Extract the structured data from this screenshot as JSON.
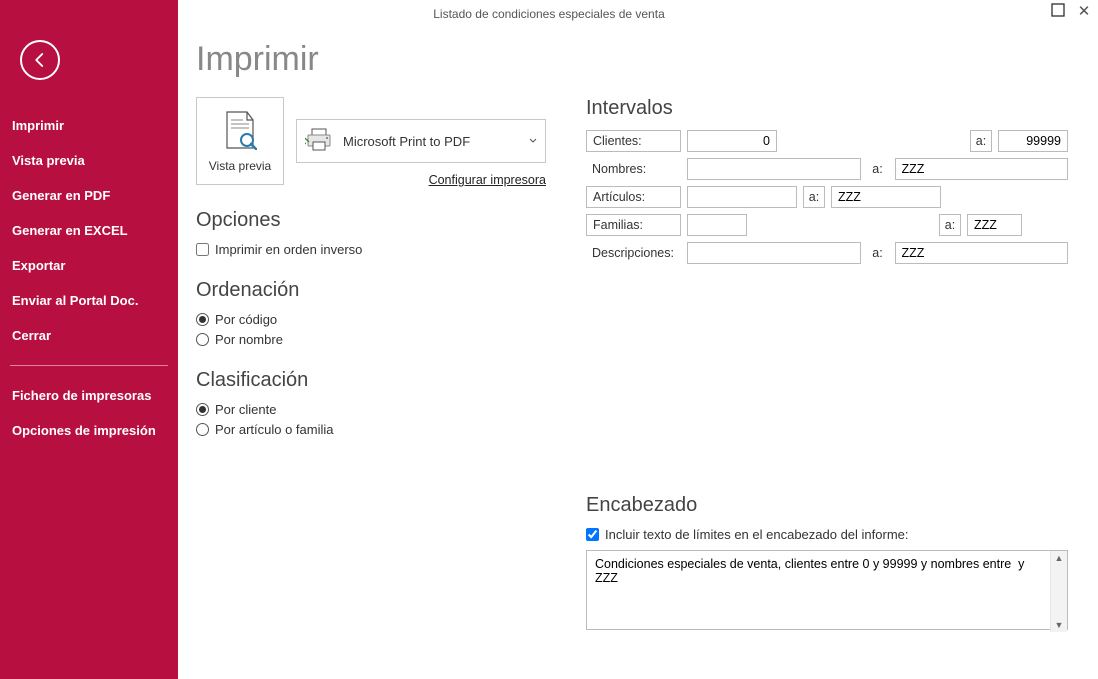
{
  "window": {
    "title": "Listado de condiciones especiales de venta"
  },
  "sidebar": {
    "items": [
      "Imprimir",
      "Vista previa",
      "Generar en PDF",
      "Generar en EXCEL",
      "Exportar",
      "Enviar al Portal Doc.",
      "Cerrar"
    ],
    "items2": [
      "Fichero de impresoras",
      "Opciones de impresión"
    ]
  },
  "page": {
    "title": "Imprimir"
  },
  "preview": {
    "label": "Vista previa"
  },
  "printer": {
    "name": "Microsoft Print to PDF",
    "config_link": "Configurar impresora"
  },
  "opciones": {
    "title": "Opciones",
    "inverse_label": "Imprimir en orden inverso",
    "inverse_checked": false
  },
  "ordenacion": {
    "title": "Ordenación",
    "options": [
      "Por código",
      "Por nombre"
    ],
    "selected": 0
  },
  "clasificacion": {
    "title": "Clasificación",
    "options": [
      "Por cliente",
      "Por artículo o familia"
    ],
    "selected": 0
  },
  "intervalos": {
    "title": "Intervalos",
    "a_label": "a:",
    "clientes": {
      "label": "Clientes:",
      "from": "0",
      "to": "99999"
    },
    "nombres": {
      "label": "Nombres:",
      "from": "",
      "to": "ZZZ"
    },
    "articulos": {
      "label": "Artículos:",
      "from": "",
      "to": "ZZZ"
    },
    "familias": {
      "label": "Familias:",
      "from": "",
      "to": "ZZZ"
    },
    "descripciones": {
      "label": "Descripciones:",
      "from": "",
      "to": "ZZZ"
    }
  },
  "encabezado": {
    "title": "Encabezado",
    "include_label": "Incluir texto de límites en el encabezado del informe:",
    "include_checked": true,
    "text": "Condiciones especiales de venta, clientes entre 0 y 99999 y nombres entre  y ZZZ"
  }
}
